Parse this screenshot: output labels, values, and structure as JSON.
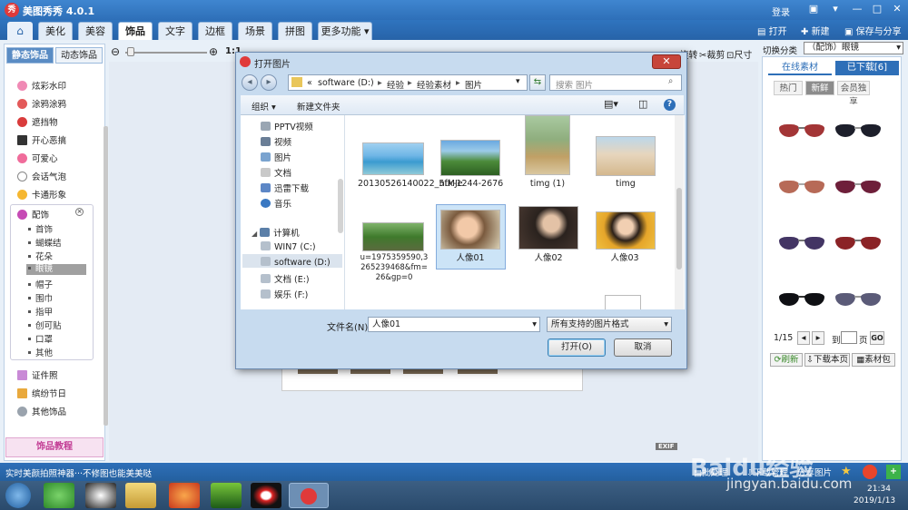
{
  "app": {
    "title": "美图秀秀 4.0.1",
    "login": "登录",
    "open": "打开",
    "new": "新建",
    "save_share": "保存与分享",
    "logo": "秀"
  },
  "tabs": [
    "美化",
    "美容",
    "饰品",
    "文字",
    "边框",
    "场景",
    "拼图",
    "更多功能"
  ],
  "left": {
    "tab_static": "静态饰品",
    "tab_dynamic": "动态饰品",
    "items": [
      "炫彩水印",
      "涂鸦涂鸦",
      "遮挡物",
      "开心恶搞",
      "可爱心",
      "会话气泡",
      "卡通形象"
    ],
    "group": "配饰",
    "subitems": [
      "首饰",
      "蝴蝶结",
      "花朵",
      "眼镜",
      "帽子",
      "围巾",
      "指甲",
      "创可贴",
      "口罩",
      "其他"
    ],
    "items2": [
      "证件照",
      "缤纷节日",
      "其他饰品"
    ],
    "tutorial": "饰品教程"
  },
  "toolbar": {
    "zoom": "1:1",
    "rotate": "旋转",
    "crop": "裁剪",
    "size": "尺寸"
  },
  "right": {
    "switch_label": "切换分类",
    "category": "（配饰）眼镜",
    "tab_online": "在线素材",
    "tab_downloaded": "已下载[6]",
    "sub": [
      "热门",
      "新鲜",
      "会员独享"
    ],
    "pager": "1/15",
    "goto": "到",
    "page": "页",
    "go": "GO",
    "refresh": "刷新",
    "download_page": "下载本页",
    "material_pack": "素材包"
  },
  "dialog": {
    "title": "打开图片",
    "path": [
      "«",
      "software (D:)",
      "经验",
      "经验素材",
      "图片"
    ],
    "search_placeholder": "搜索 图片",
    "organize": "组织 ▾",
    "new_folder": "新建文件夹",
    "nav": [
      "PPTV视频",
      "视频",
      "图片",
      "文档",
      "迅雷下载",
      "音乐",
      "计算机",
      "WIN7 (C:)",
      "software (D:)",
      "文档 (E:)",
      "娱乐 (F:)"
    ],
    "files": [
      {
        "name": "20130526140022_5fMJe"
      },
      {
        "name": "ntk-1244-2676"
      },
      {
        "name": "timg (1)"
      },
      {
        "name": "timg"
      },
      {
        "name": "u=1975359590,3265239468&fm=26&gp=0"
      },
      {
        "name": "人像01"
      },
      {
        "name": "人像02"
      },
      {
        "name": "人像03"
      }
    ],
    "filename_label": "文件名(N):",
    "filename_value": "人像01",
    "filetype": "所有支持的图片格式",
    "open_btn": "打开(O)",
    "cancel_btn": "取消"
  },
  "status": {
    "tip": "实时美颜拍照神器···不修图也能美美哒",
    "batch": "批处理",
    "download_mgr": "下载管理",
    "share_pic": "分享图片",
    "exif": "EXIF"
  },
  "taskbar": {
    "time": "21:34",
    "date": "2019/1/13"
  },
  "watermark": {
    "brand": "Baidu经验",
    "url": "jingyan.baidu.com"
  },
  "colors": {
    "accent": "#2e6fb8",
    "selected": "#cce4f7",
    "close": "#c7453a"
  }
}
